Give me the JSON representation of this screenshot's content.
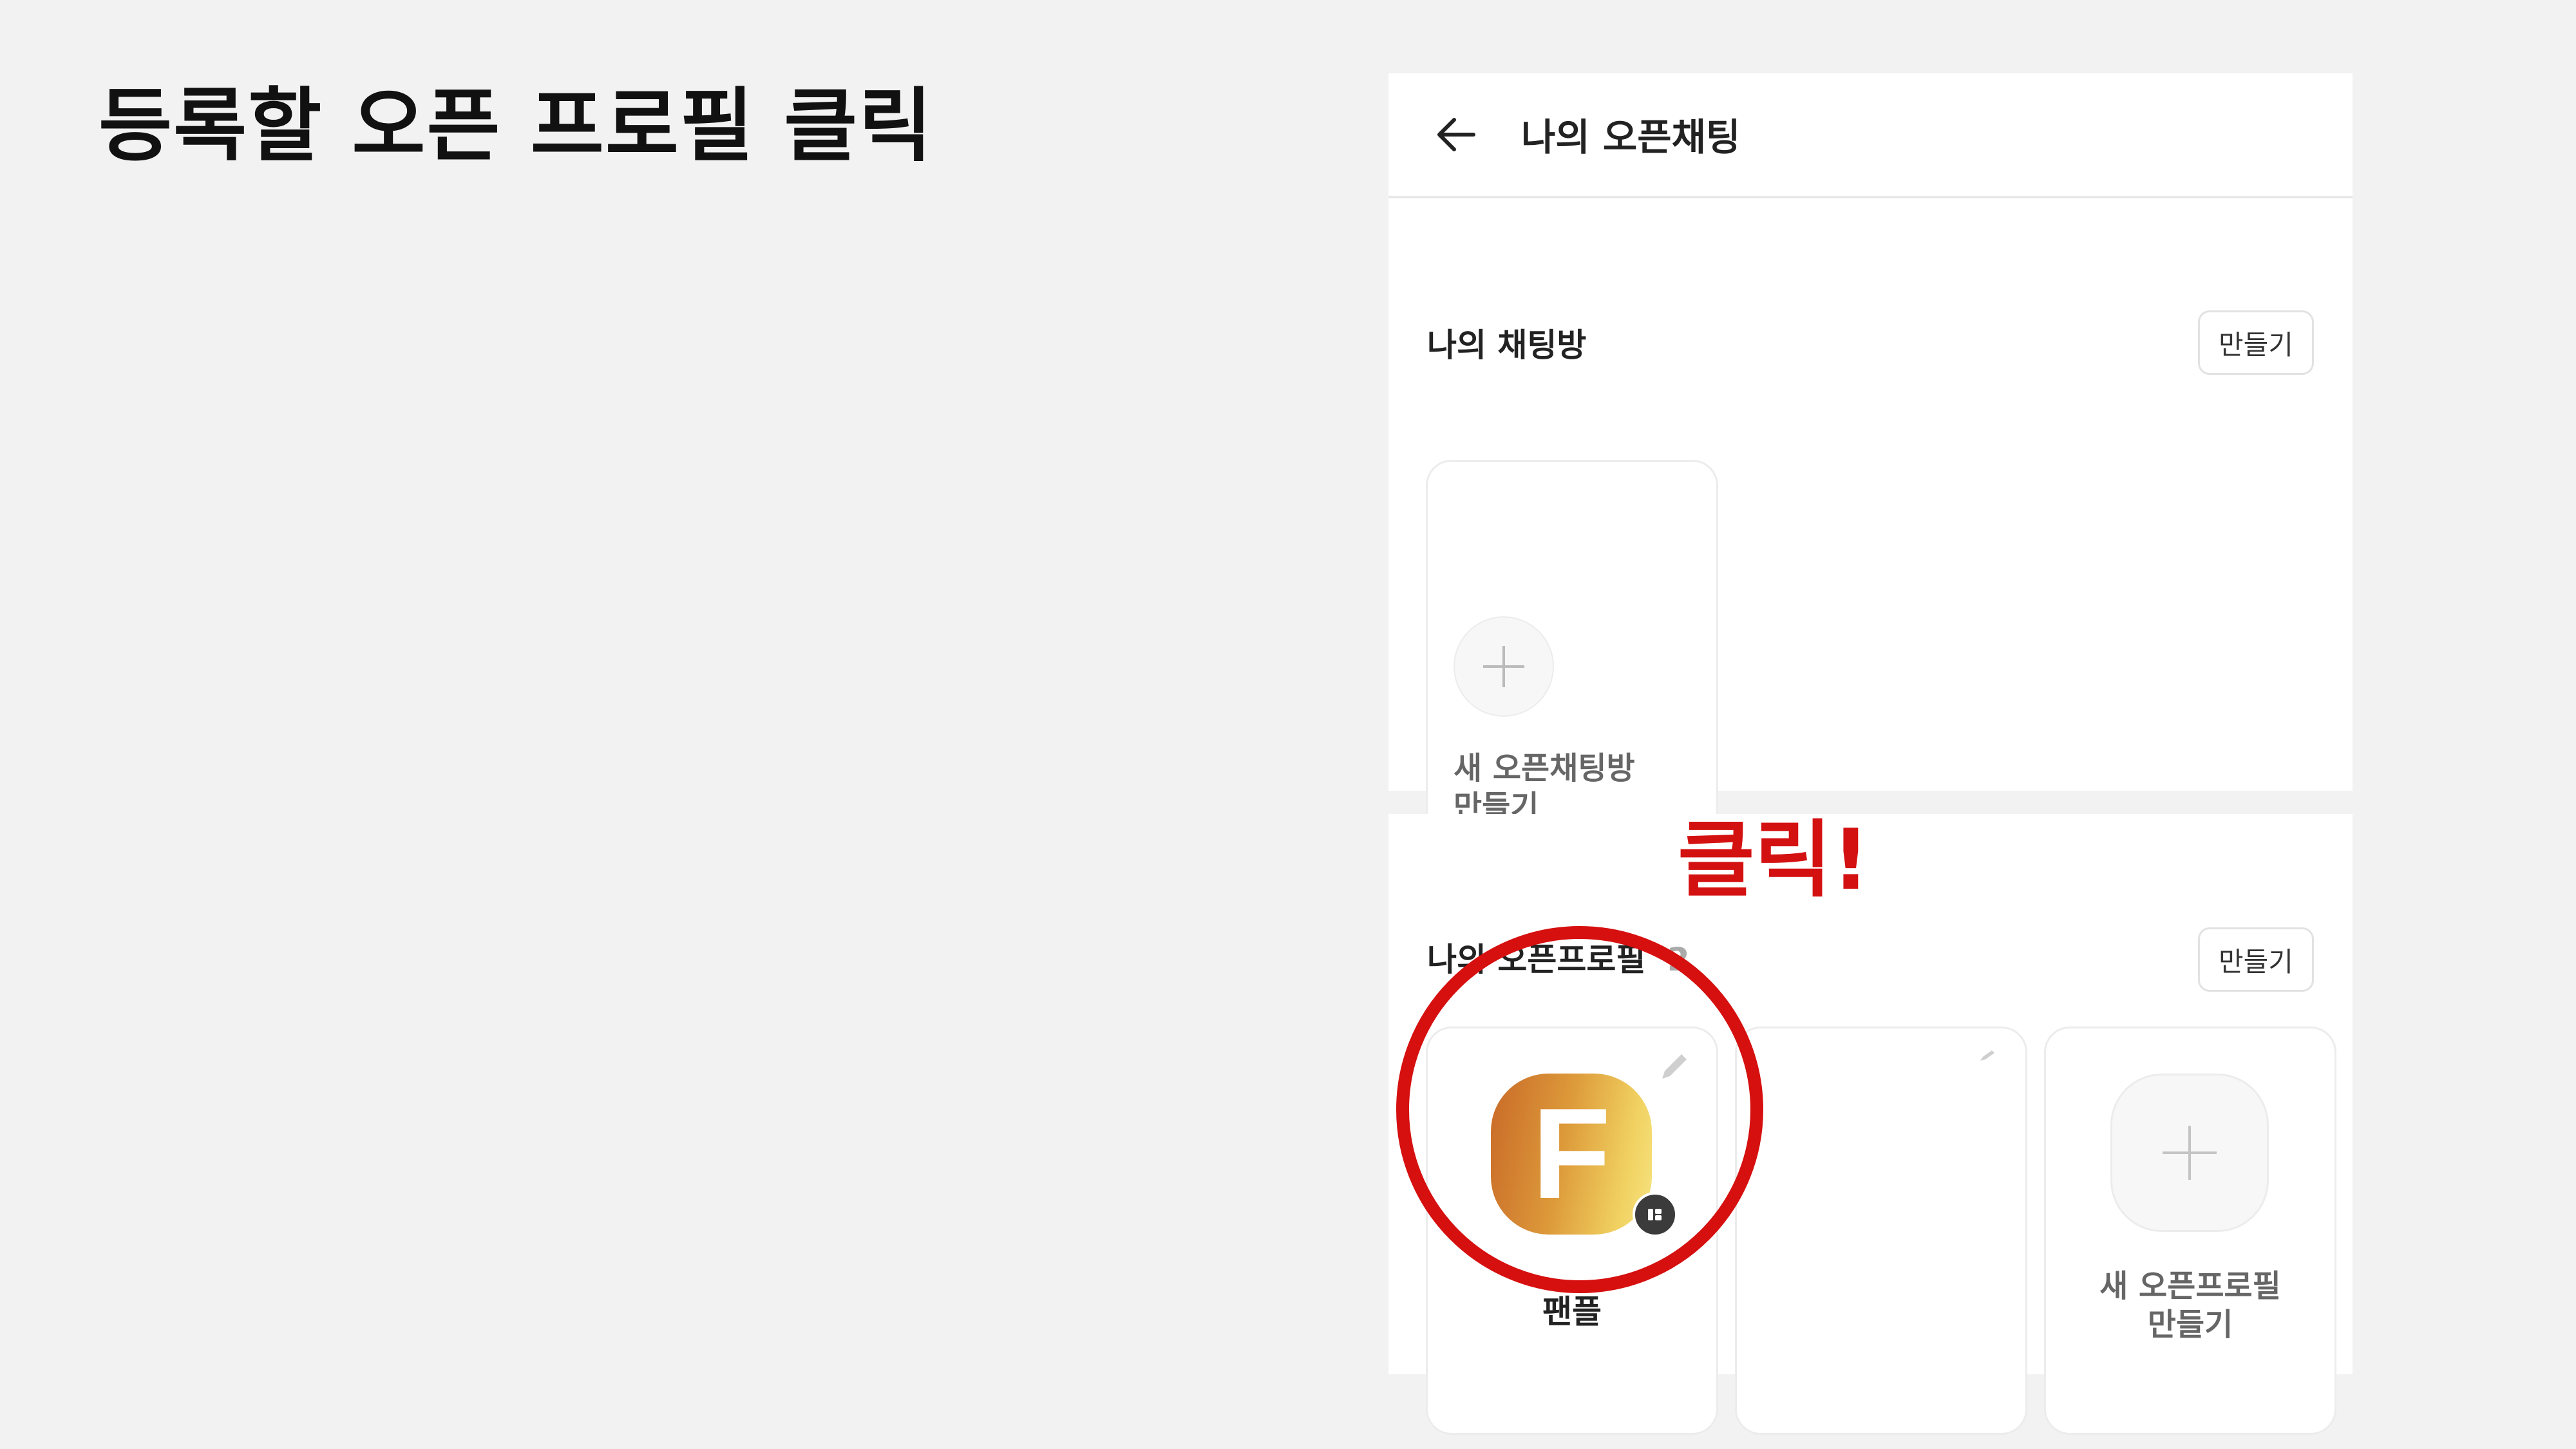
{
  "slide": {
    "title": "등록할 오픈 프로필 클릭"
  },
  "header": {
    "title": "나의 오픈채팅",
    "back_icon": "arrow-left-icon"
  },
  "chatrooms": {
    "title": "나의 채팅방",
    "make_label": "만들기",
    "new_card_line1": "새 오픈채팅방",
    "new_card_line2": "만들기"
  },
  "profiles": {
    "title": "나의 오픈프로필",
    "count": "2",
    "make_label": "만들기",
    "items": [
      {
        "name": "팬플",
        "avatar_letter": "F"
      }
    ],
    "new_card_line1": "새 오픈프로필",
    "new_card_line2": "만들기"
  },
  "annotation": {
    "text": "클릭!",
    "color": "#d41111"
  }
}
